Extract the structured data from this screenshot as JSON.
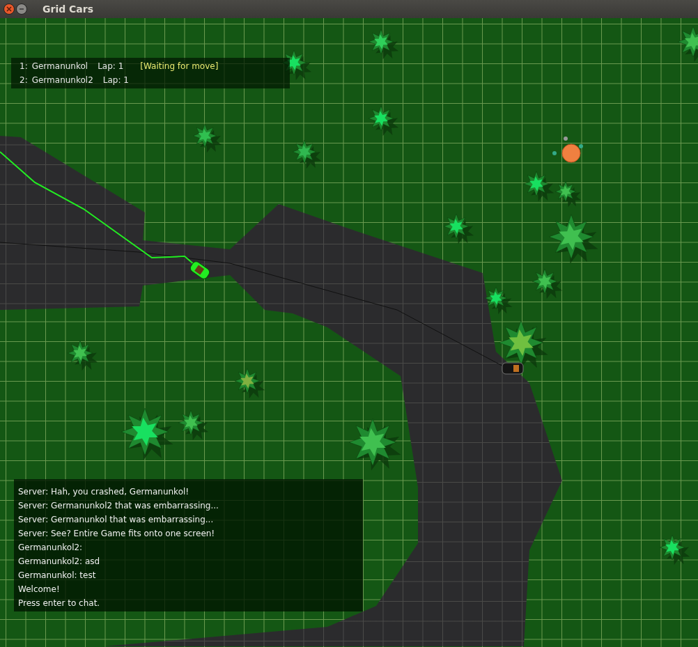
{
  "window": {
    "title": "Grid Cars"
  },
  "players": [
    {
      "number": "1:",
      "name": "Germanunkol",
      "lap": "Lap: 1",
      "status": "[Waiting for move]"
    },
    {
      "number": "2:",
      "name": "Germanunkol2",
      "lap": "Lap: 1"
    }
  ],
  "chat": {
    "lines": [
      "Server: Hah, you crashed, Germanunkol!",
      "Server: Germanunkol2 that was embarrassing...",
      "Server: Germanunkol that was embarrassing...",
      "Server: See? Entire Game fits onto one screen!",
      "Germanunkol2:",
      "Germanunkol2: asd",
      "Germanunkol: test",
      "Welcome!",
      "Press enter to chat."
    ]
  }
}
